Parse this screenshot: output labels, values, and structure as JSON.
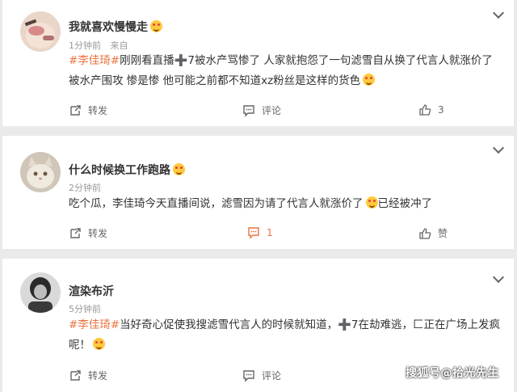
{
  "comments": [
    {
      "username": "我就喜欢慢慢走",
      "time": "1分钟前",
      "source": "来自",
      "hashtag": "#李佳琦#",
      "body_line1": "刚刚看直播➕7被水产骂惨了 人家就抱怨了一句滤雪自从换了代言人就涨价了",
      "body_line2": "被水产围攻 惨是惨 他可能之前都不知道xz粉丝是这样的货色",
      "repost_label": "转发",
      "comment_label": "评论",
      "like_count": "3"
    },
    {
      "username": "什么时候换工作跑路",
      "time": "2分钟前",
      "source": "",
      "body_line1": "吃个瓜，李佳琦今天直播间说，滤雪因为请了代言人就涨价了",
      "body_tail": "已经被冲了",
      "repost_label": "转发",
      "comment_count": "1",
      "like_label": "赞"
    },
    {
      "username": "渲染布沂",
      "time": "5分钟前",
      "source": "",
      "hashtag": "#李佳琦#",
      "body_line1": "当好奇心促使我搜滤雪代言人的时候就知道，➕7在劫难逃，匚正在广场上发疯",
      "body_line2": "呢！",
      "repost_label": "转发",
      "comment_label": "评论"
    }
  ],
  "watermark": "搜狐号@拾光先生",
  "colors": {
    "accent": "#eb7340",
    "text": "#333333",
    "meta": "#999999"
  },
  "icons": [
    "more-chevron-icon",
    "repost-icon",
    "comment-icon",
    "like-icon",
    "emoji-icon"
  ]
}
